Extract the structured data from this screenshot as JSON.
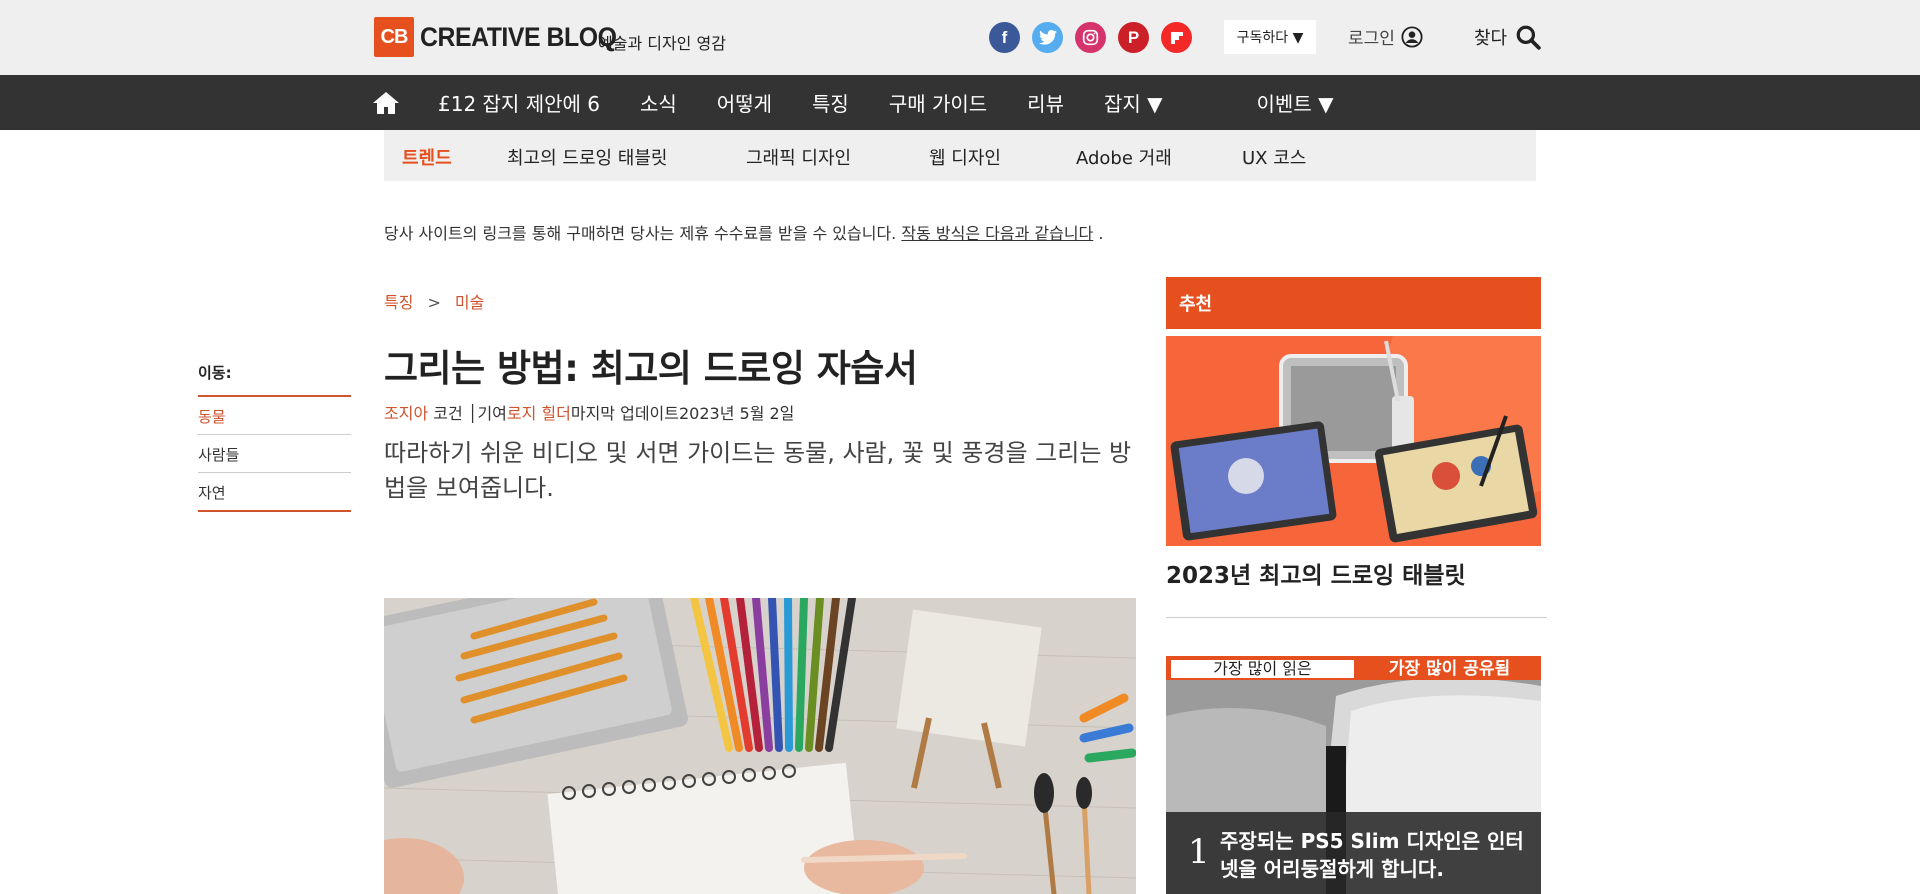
{
  "header": {
    "logo_mark": "CB",
    "logo_text": "CREATIVE BLOQ",
    "tagline": "예술과 디자인 영감",
    "social": [
      {
        "icon": "facebook-icon",
        "glyph": "f",
        "color": "#3b5998"
      },
      {
        "icon": "twitter-icon",
        "glyph": "t",
        "color": "#55acee"
      },
      {
        "icon": "instagram-icon",
        "glyph": "◎",
        "color": "#d6336c"
      },
      {
        "icon": "pinterest-icon",
        "glyph": "P",
        "color": "#cb2027"
      },
      {
        "icon": "flipboard-icon",
        "glyph": "F",
        "color": "#f52828"
      }
    ],
    "subscribe_label": "구독하다 ▼",
    "login_label": "로그인",
    "find_label": "찾다"
  },
  "main_nav": {
    "items": [
      "£12 잡지 제안에 6",
      "소식",
      "어떻게",
      "특징",
      "구매 가이드",
      "리뷰",
      "잡지 ▼",
      "이벤트 ▼"
    ]
  },
  "sub_nav": {
    "items": [
      "트렌드",
      "최고의 드로잉 태블릿",
      "그래픽 디자인",
      "웹 디자인",
      "Adobe 거래",
      "UX 코스"
    ]
  },
  "disclaimer": {
    "text": "당사 사이트의 링크를 통해 구매하면 당사는 제휴 수수료를 받을 수 있습니다. ",
    "link": "작동 방식은 다음과 같습니다",
    "end": " ."
  },
  "breadcrumb": {
    "first": "특징",
    "sep": ">",
    "second": "미술"
  },
  "jump": {
    "title": "이동:",
    "items": [
      "동물",
      "사람들",
      "자연"
    ]
  },
  "article": {
    "headline": "그리는 방법: 최고의 드로잉 자습서",
    "author": "조지아",
    "author_last": " 코건 ",
    "divider": "│",
    "contrib": "기여",
    "contributor": "로지 힐더",
    "updated": "마지막 업데이트2023년 5월 2일",
    "strap": "따라하기 쉬운 비디오 및 서면 가이드는 동물, 사람, 꽃 및 풍경을 그리는 방법을 보여줍니다."
  },
  "recommended": {
    "header": "추천",
    "title": "2023년 최고의 드로잉 태블릿"
  },
  "most": {
    "tab_read": "가장 많이 읽은",
    "tab_shared": "가장 많이 공유됨",
    "number": "1",
    "item_text": "주장되는 PS5 Slim 디자인은 인터넷을 어리둥절하게 합니다."
  }
}
